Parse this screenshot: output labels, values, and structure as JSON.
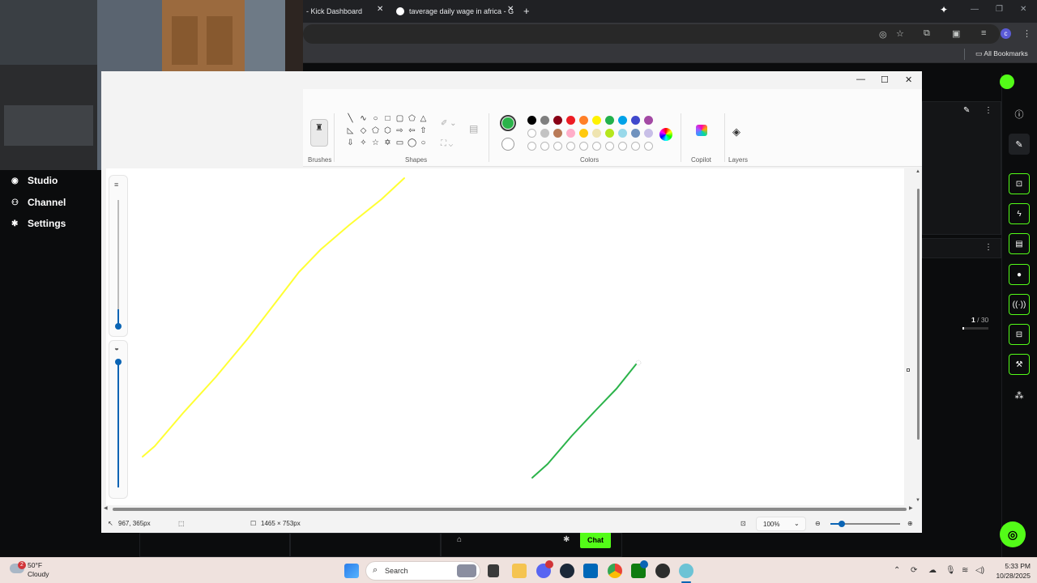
{
  "browser": {
    "tabs": [
      {
        "title": "- Kick Dashboard",
        "active": true
      },
      {
        "title": "taverage daily wage in africa - G",
        "active": false
      }
    ],
    "bookmarks_label": "All Bookmarks"
  },
  "kick": {
    "nav": [
      {
        "label": "Studio",
        "icon": "studio-icon"
      },
      {
        "label": "Channel",
        "icon": "channel-icon"
      },
      {
        "label": "Settings",
        "icon": "gear-icon"
      }
    ],
    "pagination": {
      "current": "1",
      "total": "/ 30"
    },
    "chat_label": "Chat",
    "accent": "#53fc18"
  },
  "paint": {
    "groups": {
      "brushes": "Brushes",
      "shapes": "Shapes",
      "colors": "Colors",
      "copilot": "Copilot",
      "layers": "Layers"
    },
    "selected_color": "#2bb34a",
    "palette_row1": [
      "#000000",
      "#7f7f7f",
      "#880015",
      "#ed1c24",
      "#ff7f27",
      "#fff200",
      "#22b14c",
      "#00a2e8",
      "#3f48cc",
      "#a349a4"
    ],
    "palette_row2": [
      "#ffffff",
      "#c3c3c3",
      "#b97a57",
      "#ffaec9",
      "#ffc90e",
      "#efe4b0",
      "#b5e61d",
      "#99d9ea",
      "#7092be",
      "#c8bfe7"
    ],
    "status": {
      "cursor": "967, 365px",
      "dimensions": "1465 × 753px",
      "zoom": "100%"
    },
    "strokes": [
      {
        "color": "#ffff33",
        "description": "yellow"
      },
      {
        "color": "#2bb34a",
        "description": "green"
      }
    ]
  },
  "taskbar": {
    "weather_temp": "50°F",
    "weather_desc": "Cloudy",
    "weather_badge": "2",
    "search_placeholder": "Search",
    "time": "5:33 PM",
    "date": "10/28/2025"
  }
}
